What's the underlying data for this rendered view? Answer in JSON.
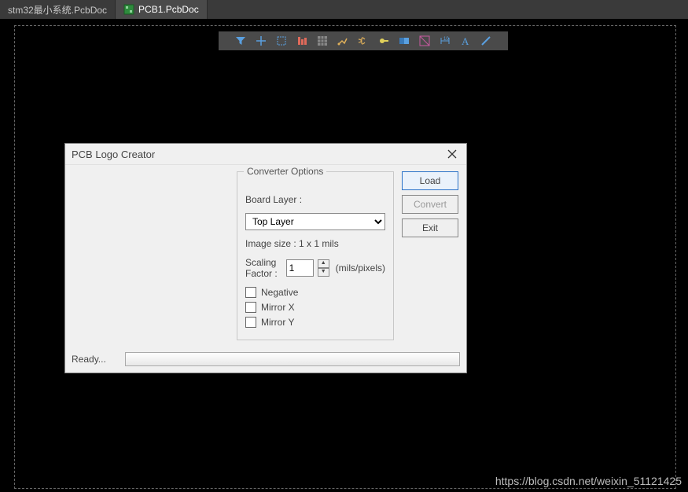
{
  "tabs": [
    {
      "label": "stm32最小系统.PcbDoc",
      "active_class": "inactive"
    },
    {
      "label": "PCB1.PcbDoc",
      "active_class": "active"
    }
  ],
  "toolbar_icons": [
    "filter-icon",
    "place-cross-icon",
    "select-rect-icon",
    "align-icon",
    "grid-icon",
    "route-icon",
    "diff-pair-icon",
    "via-key-icon",
    "plane-icon",
    "measure-icon",
    "dimension-icon",
    "text-icon",
    "line-icon"
  ],
  "dialog": {
    "title": "PCB Logo Creator",
    "converter_legend": "Converter Options",
    "board_layer_label": "Board Layer :",
    "board_layer_value": "Top Layer",
    "image_size_text": "Image size : 1 x 1 mils",
    "scaling_label": "Scaling Factor :",
    "scaling_value": "1",
    "scaling_units": "(mils/pixels)",
    "chk_negative": "Negative",
    "chk_mirror_x": "Mirror X",
    "chk_mirror_y": "Mirror Y",
    "btn_load": "Load",
    "btn_convert": "Convert",
    "btn_exit": "Exit",
    "status": "Ready..."
  },
  "watermark": "https://blog.csdn.net/weixin_51121425"
}
